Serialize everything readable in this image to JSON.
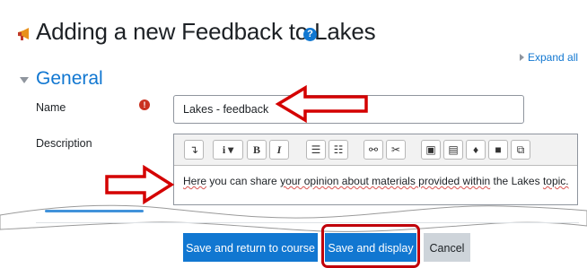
{
  "header": {
    "title": "Adding a new Feedback to Lakes",
    "help_glyph": "?",
    "expand_all": "Expand all"
  },
  "section": {
    "title": "General"
  },
  "form": {
    "name_label": "Name",
    "name_value": "Lakes - feedback",
    "description_label": "Description",
    "required_glyph": "!",
    "description_text": {
      "p1": "Here",
      "p2": " you can share ",
      "p3": "your opinion about materials provided within",
      "p4": " the Lakes ",
      "p5": "topic."
    }
  },
  "toolbar": {
    "buttons": [
      "format",
      "info",
      "bold",
      "italic",
      "unordered-list",
      "ordered-list",
      "link",
      "unlink",
      "image",
      "media",
      "record-audio",
      "record-video",
      "manage-files"
    ],
    "bold": "B",
    "italic": "I",
    "info": "i"
  },
  "footer_buttons": {
    "save_return": "Save and return to course",
    "save_display": "Save and display",
    "cancel": "Cancel"
  },
  "colors": {
    "accent": "#1177d1",
    "required": "#ca3120",
    "annotation": "#c0000a"
  },
  "icons": [
    "megaphone-icon",
    "help-icon",
    "caret-right-icon",
    "chevron-down-icon",
    "required-icon",
    "arrow-annotation-icon"
  ]
}
